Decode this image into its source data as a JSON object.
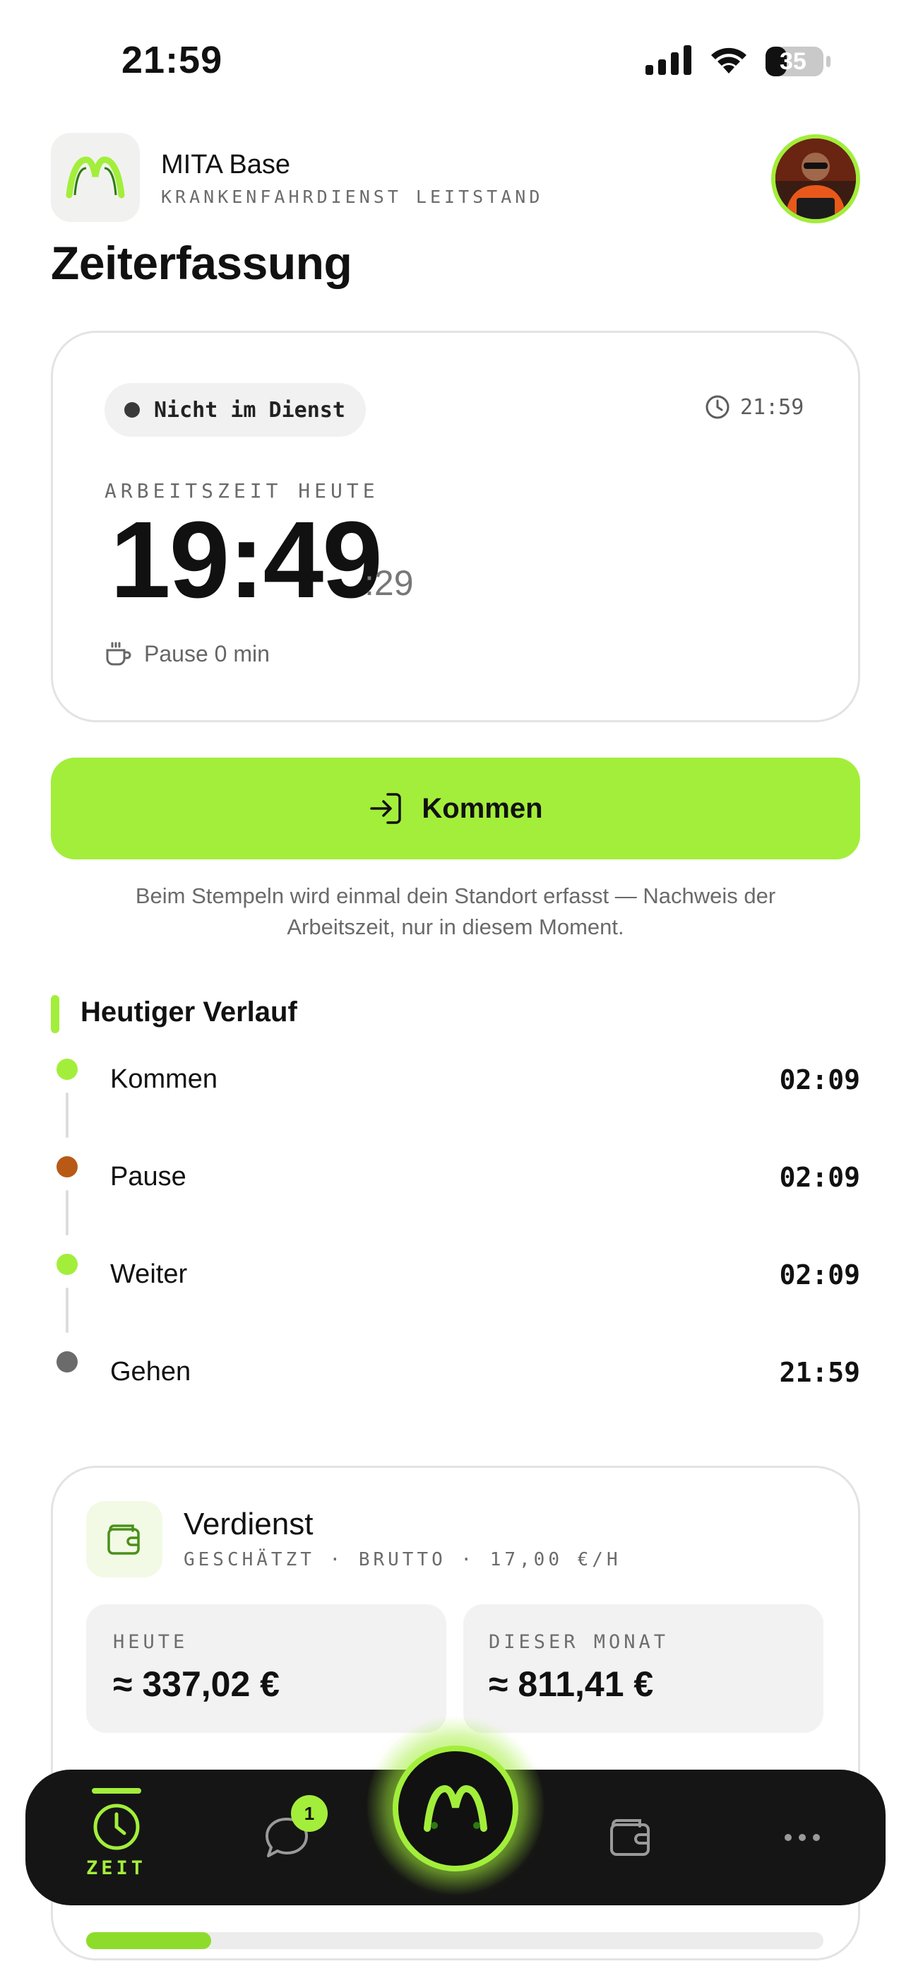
{
  "status_bar": {
    "time": "21:59",
    "battery": "35",
    "icons": [
      "signal-icon",
      "wifi-icon",
      "battery-icon"
    ]
  },
  "header": {
    "brand_name": "MITA Base",
    "brand_sub": "KRANKENFAHRDIENST LEITSTAND",
    "title": "Zeiterfassung"
  },
  "time_card": {
    "status": "Nicht im Dienst",
    "clock": "21:59",
    "work_label": "ARBEITSZEIT HEUTE",
    "hours_minutes": "19:49",
    "seconds": ":29",
    "pause": "Pause 0 min"
  },
  "actions": {
    "kommen_label": "Kommen",
    "hint": "Beim Stempeln wird einmal dein Standort erfasst — Nachweis der Arbeitszeit, nur in diesem Moment."
  },
  "timeline": {
    "title": "Heutiger Verlauf",
    "entries": [
      {
        "label": "Kommen",
        "time": "02:09",
        "color": "#a3ee3b"
      },
      {
        "label": "Pause",
        "time": "02:09",
        "color": "#b85a16"
      },
      {
        "label": "Weiter",
        "time": "02:09",
        "color": "#a3ee3b"
      },
      {
        "label": "Gehen",
        "time": "21:59",
        "color": "#6b6b6b"
      }
    ]
  },
  "earnings": {
    "title": "Verdienst",
    "subtitle": "GESCHÄTZT · BRUTTO · 17,00 €/H",
    "today_label": "HEUTE",
    "today_value": "≈ 337,02 €",
    "month_label": "DIESER MONAT",
    "month_value": "≈ 811,41 €",
    "progress": 0.17
  },
  "nav": {
    "zeit_label": "ZEIT",
    "chat_badge": "1"
  },
  "colors": {
    "accent": "#a3ee3b",
    "pause": "#b85a16",
    "dark": "#151515"
  }
}
